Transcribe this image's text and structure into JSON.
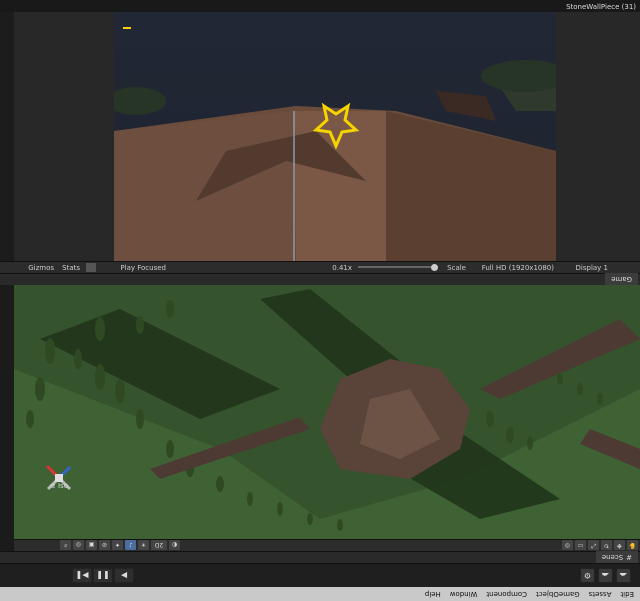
{
  "window": {
    "title": "StoneWallPiece (31)"
  },
  "menu": [
    "Edit",
    "Assets",
    "GameObject",
    "Component",
    "Window",
    "Help"
  ],
  "toolbar": {
    "play": "▶",
    "pause": "❚❚",
    "step": "▶❚"
  },
  "scene": {
    "tab_label": "Scene",
    "projection_label": "≡ Iso",
    "tool_2d": "2D"
  },
  "game": {
    "tab_label": "Game",
    "display": "Display 1",
    "resolution": "Full HD (1920x1080)",
    "scale_label": "Scale",
    "scale_value": "0.41x",
    "play_focused": "Play Focused",
    "stats": "Stats",
    "gizmos": "Gizmos"
  },
  "colors": {
    "accent_blue": "#4a6ea0",
    "gizmo_yellow": "#f5d400",
    "terrain_green": "#3e6233",
    "sky": "#2a3448"
  }
}
